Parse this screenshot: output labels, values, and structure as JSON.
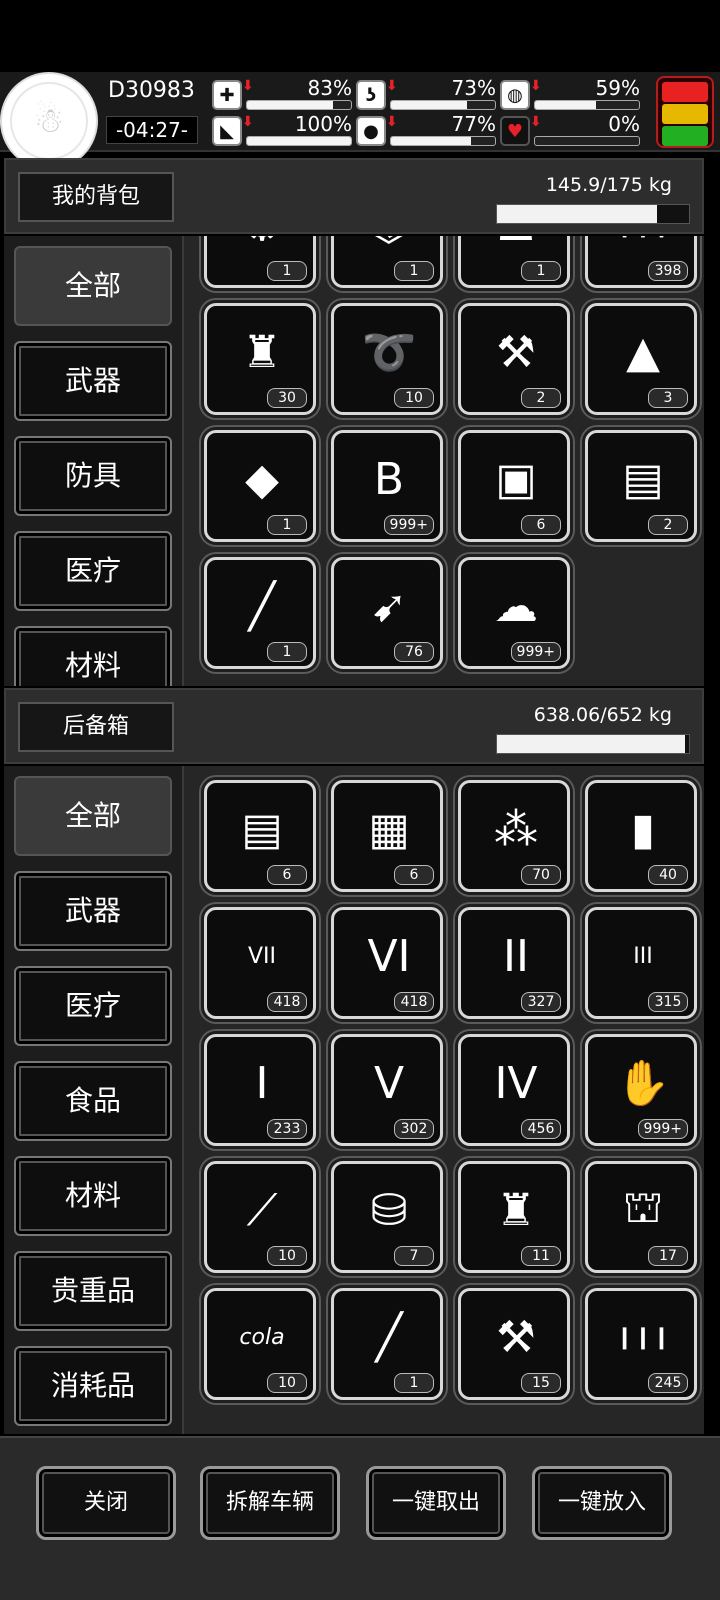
{
  "hud": {
    "day": "D30983",
    "time": "-04:27-",
    "stats": [
      {
        "icon": "medkit-icon",
        "glyph": "✚",
        "pct_text": "83%",
        "value": 0.83
      },
      {
        "icon": "stomach-icon",
        "glyph": "ʖ",
        "pct_text": "73%",
        "value": 0.73
      },
      {
        "icon": "pill-icon",
        "glyph": "◍",
        "pct_text": "59%",
        "value": 0.59
      },
      {
        "icon": "boot-icon",
        "glyph": "◣",
        "pct_text": "100%",
        "value": 1.0
      },
      {
        "icon": "water-drop-icon",
        "glyph": "●",
        "pct_text": "77%",
        "value": 0.77
      },
      {
        "icon": "heart-icon",
        "glyph": "♥",
        "pct_text": "0%",
        "value": 0.0
      }
    ],
    "status_colors": [
      "#e82222",
      "#e6b800",
      "#22b022"
    ]
  },
  "backpack": {
    "title": "我的背包",
    "weight": "145.9/175 kg",
    "weight_fraction": 0.834,
    "categories": [
      "全部",
      "武器",
      "防具",
      "医疗",
      "材料"
    ],
    "items": [
      {
        "name": "scrap-wire-icon",
        "glyph": "⚙",
        "count": "1"
      },
      {
        "name": "robot-part-icon",
        "glyph": "⌬",
        "count": "1"
      },
      {
        "name": "helmet-icon",
        "glyph": "☗",
        "count": "1"
      },
      {
        "name": "bullets-icon",
        "glyph": "❙❙❙",
        "count": "398"
      },
      {
        "name": "grenades-icon",
        "glyph": "♜",
        "count": "30"
      },
      {
        "name": "rope-icon",
        "glyph": "➰",
        "count": "10"
      },
      {
        "name": "toolbox-icon",
        "glyph": "⚒",
        "count": "2"
      },
      {
        "name": "cloth-scrap-icon",
        "glyph": "▲",
        "count": "3"
      },
      {
        "name": "gold-crystal-icon",
        "glyph": "◆",
        "count": "1"
      },
      {
        "name": "coin-icon",
        "glyph": "B",
        "count": "999+"
      },
      {
        "name": "treasure-chest-icon",
        "glyph": "▣",
        "count": "6"
      },
      {
        "name": "tool-case-icon",
        "glyph": "▤",
        "count": "2"
      },
      {
        "name": "rpg-launcher-icon",
        "glyph": "╱",
        "count": "1"
      },
      {
        "name": "rocket-icon",
        "glyph": "➹",
        "count": "76"
      },
      {
        "name": "fabric-icon",
        "glyph": "☁",
        "count": "999+"
      }
    ]
  },
  "trunk": {
    "title": "后备箱",
    "weight": "638.06/652 kg",
    "weight_fraction": 0.979,
    "categories": [
      "全部",
      "武器",
      "医疗",
      "食品",
      "材料",
      "贵重品",
      "消耗品"
    ],
    "items": [
      {
        "name": "tool-case-icon",
        "glyph": "▤",
        "count": "6"
      },
      {
        "name": "repair-kit-icon",
        "glyph": "▦",
        "count": "6"
      },
      {
        "name": "skewer-icon",
        "glyph": "⁂",
        "count": "70"
      },
      {
        "name": "water-bottle-icon",
        "glyph": "▮",
        "count": "40"
      },
      {
        "name": "test-tube-vii-icon",
        "glyph": "VII",
        "count": "418"
      },
      {
        "name": "test-tube-vi-icon",
        "glyph": "VI",
        "count": "418"
      },
      {
        "name": "test-tube-ii-icon",
        "glyph": "II",
        "count": "327"
      },
      {
        "name": "test-tube-iii-icon",
        "glyph": "III",
        "count": "315"
      },
      {
        "name": "test-tube-i-icon",
        "glyph": "I",
        "count": "233"
      },
      {
        "name": "test-tube-v-icon",
        "glyph": "V",
        "count": "302"
      },
      {
        "name": "test-tube-iv-icon",
        "glyph": "IV",
        "count": "456"
      },
      {
        "name": "zombie-card-icon",
        "glyph": "✋",
        "count": "999+"
      },
      {
        "name": "tube-roll-icon",
        "glyph": "⟋",
        "count": "10"
      },
      {
        "name": "pill-bottle-icon",
        "glyph": "⛁",
        "count": "7"
      },
      {
        "name": "grenades-icon",
        "glyph": "♜",
        "count": "11"
      },
      {
        "name": "popcorn-icon",
        "glyph": "⛫",
        "count": "17"
      },
      {
        "name": "cola-cup-icon",
        "glyph": "cola",
        "count": "10"
      },
      {
        "name": "rpg-launcher-icon",
        "glyph": "╱",
        "count": "1"
      },
      {
        "name": "toolbox-icon",
        "glyph": "⚒",
        "count": "15"
      },
      {
        "name": "bullets-icon",
        "glyph": "❙❙❙",
        "count": "245"
      }
    ]
  },
  "footer": {
    "buttons": [
      "关闭",
      "拆解车辆",
      "一键取出",
      "一键放入"
    ]
  }
}
